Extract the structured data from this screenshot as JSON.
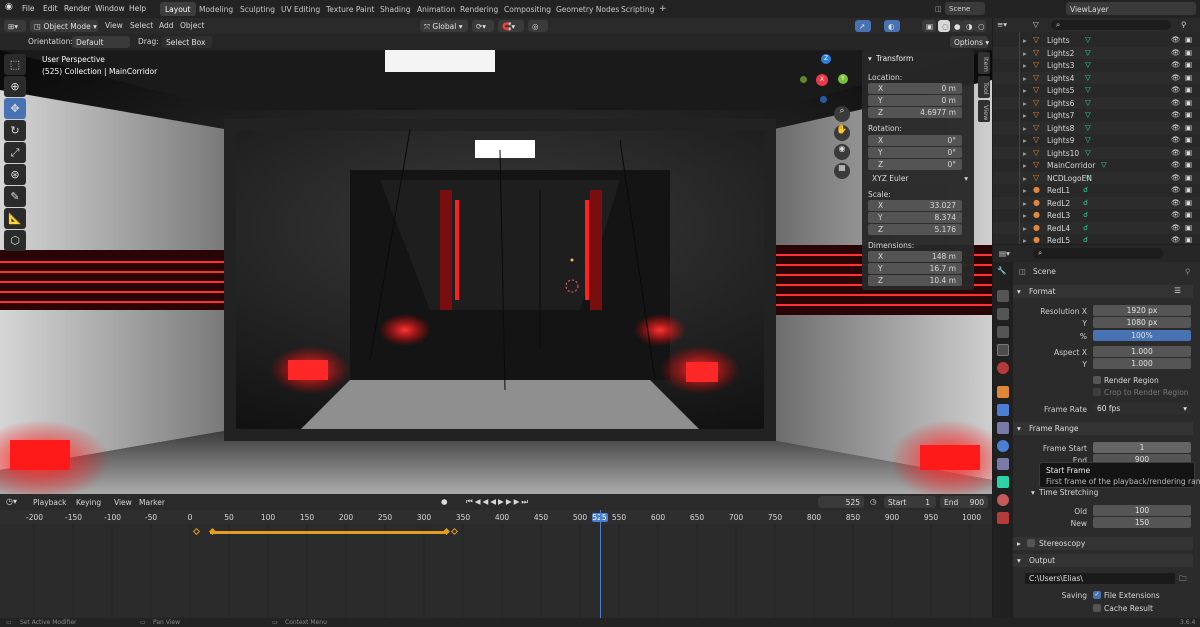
{
  "menu": {
    "items": [
      "File",
      "Edit",
      "Render",
      "Window",
      "Help"
    ],
    "workspaces": [
      "Layout",
      "Modeling",
      "Sculpting",
      "UV Editing",
      "Texture Paint",
      "Shading",
      "Animation",
      "Rendering",
      "Compositing",
      "Geometry Nodes",
      "Scripting"
    ],
    "active_workspace": "Layout",
    "scene": "Scene",
    "view_layer": "ViewLayer"
  },
  "viewport_header": {
    "mode": "Object Mode",
    "menus": [
      "View",
      "Select",
      "Add",
      "Object"
    ],
    "orientation": "Global"
  },
  "tool_settings": {
    "orientation_label": "Orientation:",
    "orientation_value": "Default",
    "drag_label": "Drag:",
    "drag_value": "Select Box",
    "options": "Options"
  },
  "viewport": {
    "perspective": "User Perspective",
    "collection_info": "(525) Collection | MainCorridor",
    "gizmo": {
      "x": "X",
      "y": "Y",
      "z": "Z"
    }
  },
  "transform_panel": {
    "title": "Transform",
    "location_label": "Location:",
    "location": [
      {
        "axis": "X",
        "value": "0 m"
      },
      {
        "axis": "Y",
        "value": "0 m"
      },
      {
        "axis": "Z",
        "value": "4.6977 m"
      }
    ],
    "rotation_label": "Rotation:",
    "rotation": [
      {
        "axis": "X",
        "value": "0°"
      },
      {
        "axis": "Y",
        "value": "0°"
      },
      {
        "axis": "Z",
        "value": "0°"
      }
    ],
    "rotation_mode": "XYZ Euler",
    "scale_label": "Scale:",
    "scale": [
      {
        "axis": "X",
        "value": "33.027"
      },
      {
        "axis": "Y",
        "value": "8.374"
      },
      {
        "axis": "Z",
        "value": "5.176"
      }
    ],
    "dimensions_label": "Dimensions:",
    "dimensions": [
      {
        "axis": "X",
        "value": "148 m"
      },
      {
        "axis": "Y",
        "value": "16.7 m"
      },
      {
        "axis": "Z",
        "value": "10.4 m"
      }
    ]
  },
  "side_tabs": [
    "Item",
    "Tool",
    "View"
  ],
  "timeline": {
    "menus": [
      "Playback",
      "Keying",
      "View",
      "Marker"
    ],
    "current_frame": "525",
    "start_label": "Start",
    "start": "1",
    "end_label": "End",
    "end": "900",
    "ruler": [
      "-200",
      "-150",
      "-100",
      "-50",
      "0",
      "50",
      "100",
      "150",
      "200",
      "250",
      "300",
      "350",
      "400",
      "450",
      "500",
      "525",
      "550",
      "600",
      "650",
      "700",
      "750",
      "800",
      "850",
      "900",
      "950",
      "1000"
    ]
  },
  "outliner": {
    "rows": [
      "Lights",
      "Lights2",
      "Lights3",
      "Lights4",
      "Lights5",
      "Lights6",
      "Lights7",
      "Lights8",
      "Lights9",
      "Lights10",
      "MainCorridor",
      "NCDLogoEN",
      "RedL1",
      "RedL2",
      "RedL3",
      "RedL4",
      "RedL5"
    ]
  },
  "properties": {
    "scene_label": "Scene",
    "format": {
      "title": "Format",
      "resolution_x_label": "Resolution X",
      "resolution_x": "1920 px",
      "y_label": "Y",
      "resolution_y": "1080 px",
      "percent_label": "%",
      "percent": "100%",
      "aspect_x_label": "Aspect X",
      "aspect_x": "1.000",
      "aspect_y_label": "Y",
      "aspect_y": "1.000",
      "render_region": "Render Region",
      "crop": "Crop to Render Region",
      "frame_rate_label": "Frame Rate",
      "frame_rate": "60 fps"
    },
    "frame_range": {
      "title": "Frame Range",
      "start_label": "Frame Start",
      "start": "1",
      "end_label": "End",
      "end": "900"
    },
    "tooltip": {
      "title": "Start Frame",
      "body": "First frame of the playback/rendering range."
    },
    "time_stretching": {
      "title": "Time Stretching",
      "old_label": "Old",
      "old": "100",
      "new_label": "New",
      "new": "150"
    },
    "stereoscopy": "Stereoscopy",
    "output": {
      "title": "Output",
      "path": "C:\\Users\\Elias\\",
      "saving_label": "Saving",
      "file_extensions": "File Extensions",
      "cache_result": "Cache Result"
    }
  },
  "status_bar": {
    "left": "Set Active Modifier",
    "mid": "Pan View",
    "right": "Context Menu",
    "version": "3.6.4"
  },
  "colors": {
    "accent": "#4772b3",
    "keyframe": "#e29c1f",
    "playhead": "#4a7fd4",
    "light_icon": "#e0873a",
    "mesh_icon": "#2bd4a4"
  }
}
